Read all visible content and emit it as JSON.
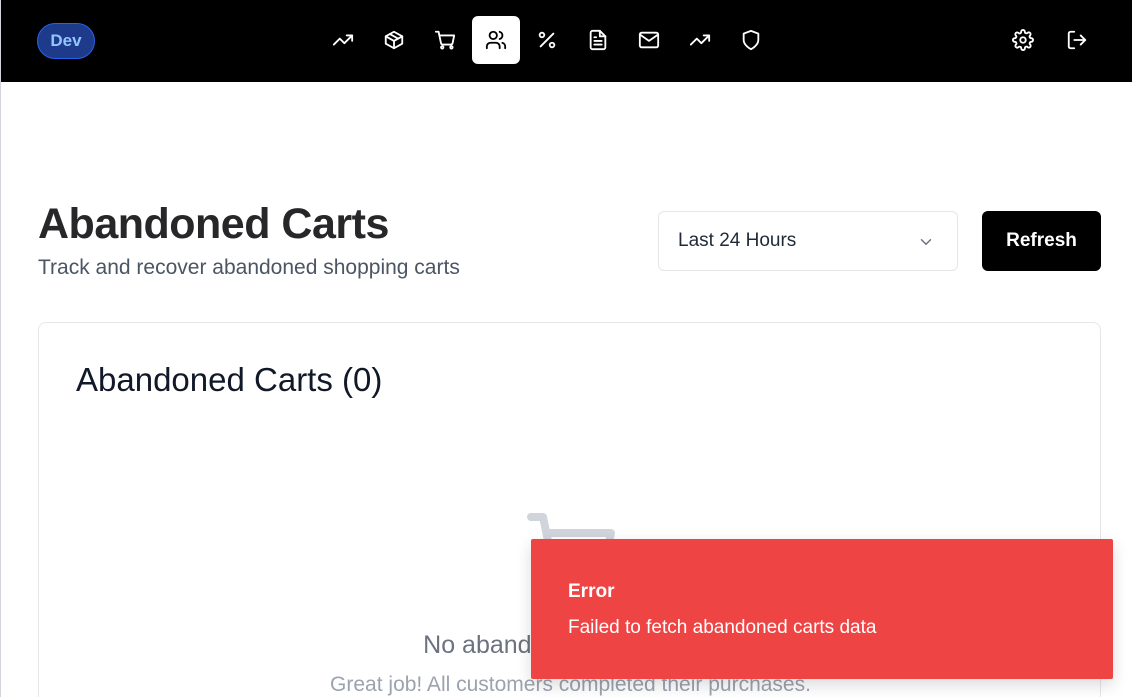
{
  "nav": {
    "env_badge": "Dev",
    "items": [
      {
        "icon": "trending-up-icon",
        "active": false
      },
      {
        "icon": "package-icon",
        "active": false
      },
      {
        "icon": "shopping-cart-icon",
        "active": false
      },
      {
        "icon": "users-icon",
        "active": true
      },
      {
        "icon": "percent-icon",
        "active": false
      },
      {
        "icon": "file-text-icon",
        "active": false
      },
      {
        "icon": "mail-icon",
        "active": false
      },
      {
        "icon": "trending-up-icon",
        "active": false
      },
      {
        "icon": "shield-icon",
        "active": false
      }
    ],
    "right_items": [
      {
        "icon": "settings-icon"
      },
      {
        "icon": "log-out-icon"
      }
    ]
  },
  "header": {
    "title": "Abandoned Carts",
    "subtitle": "Track and recover abandoned shopping carts",
    "range_select": {
      "selected": "Last 24 Hours"
    },
    "refresh_label": "Refresh"
  },
  "card": {
    "title": "Abandoned Carts (0)",
    "empty_title": "No abandoned carts found",
    "empty_subtitle": "Great job! All customers completed their purchases."
  },
  "toast": {
    "title": "Error",
    "message": "Failed to fetch abandoned carts data"
  },
  "colors": {
    "nav_bg": "#000000",
    "toast_bg": "#ef4444",
    "badge_bg": "#1e3a8a",
    "badge_text": "#93c5fd"
  }
}
